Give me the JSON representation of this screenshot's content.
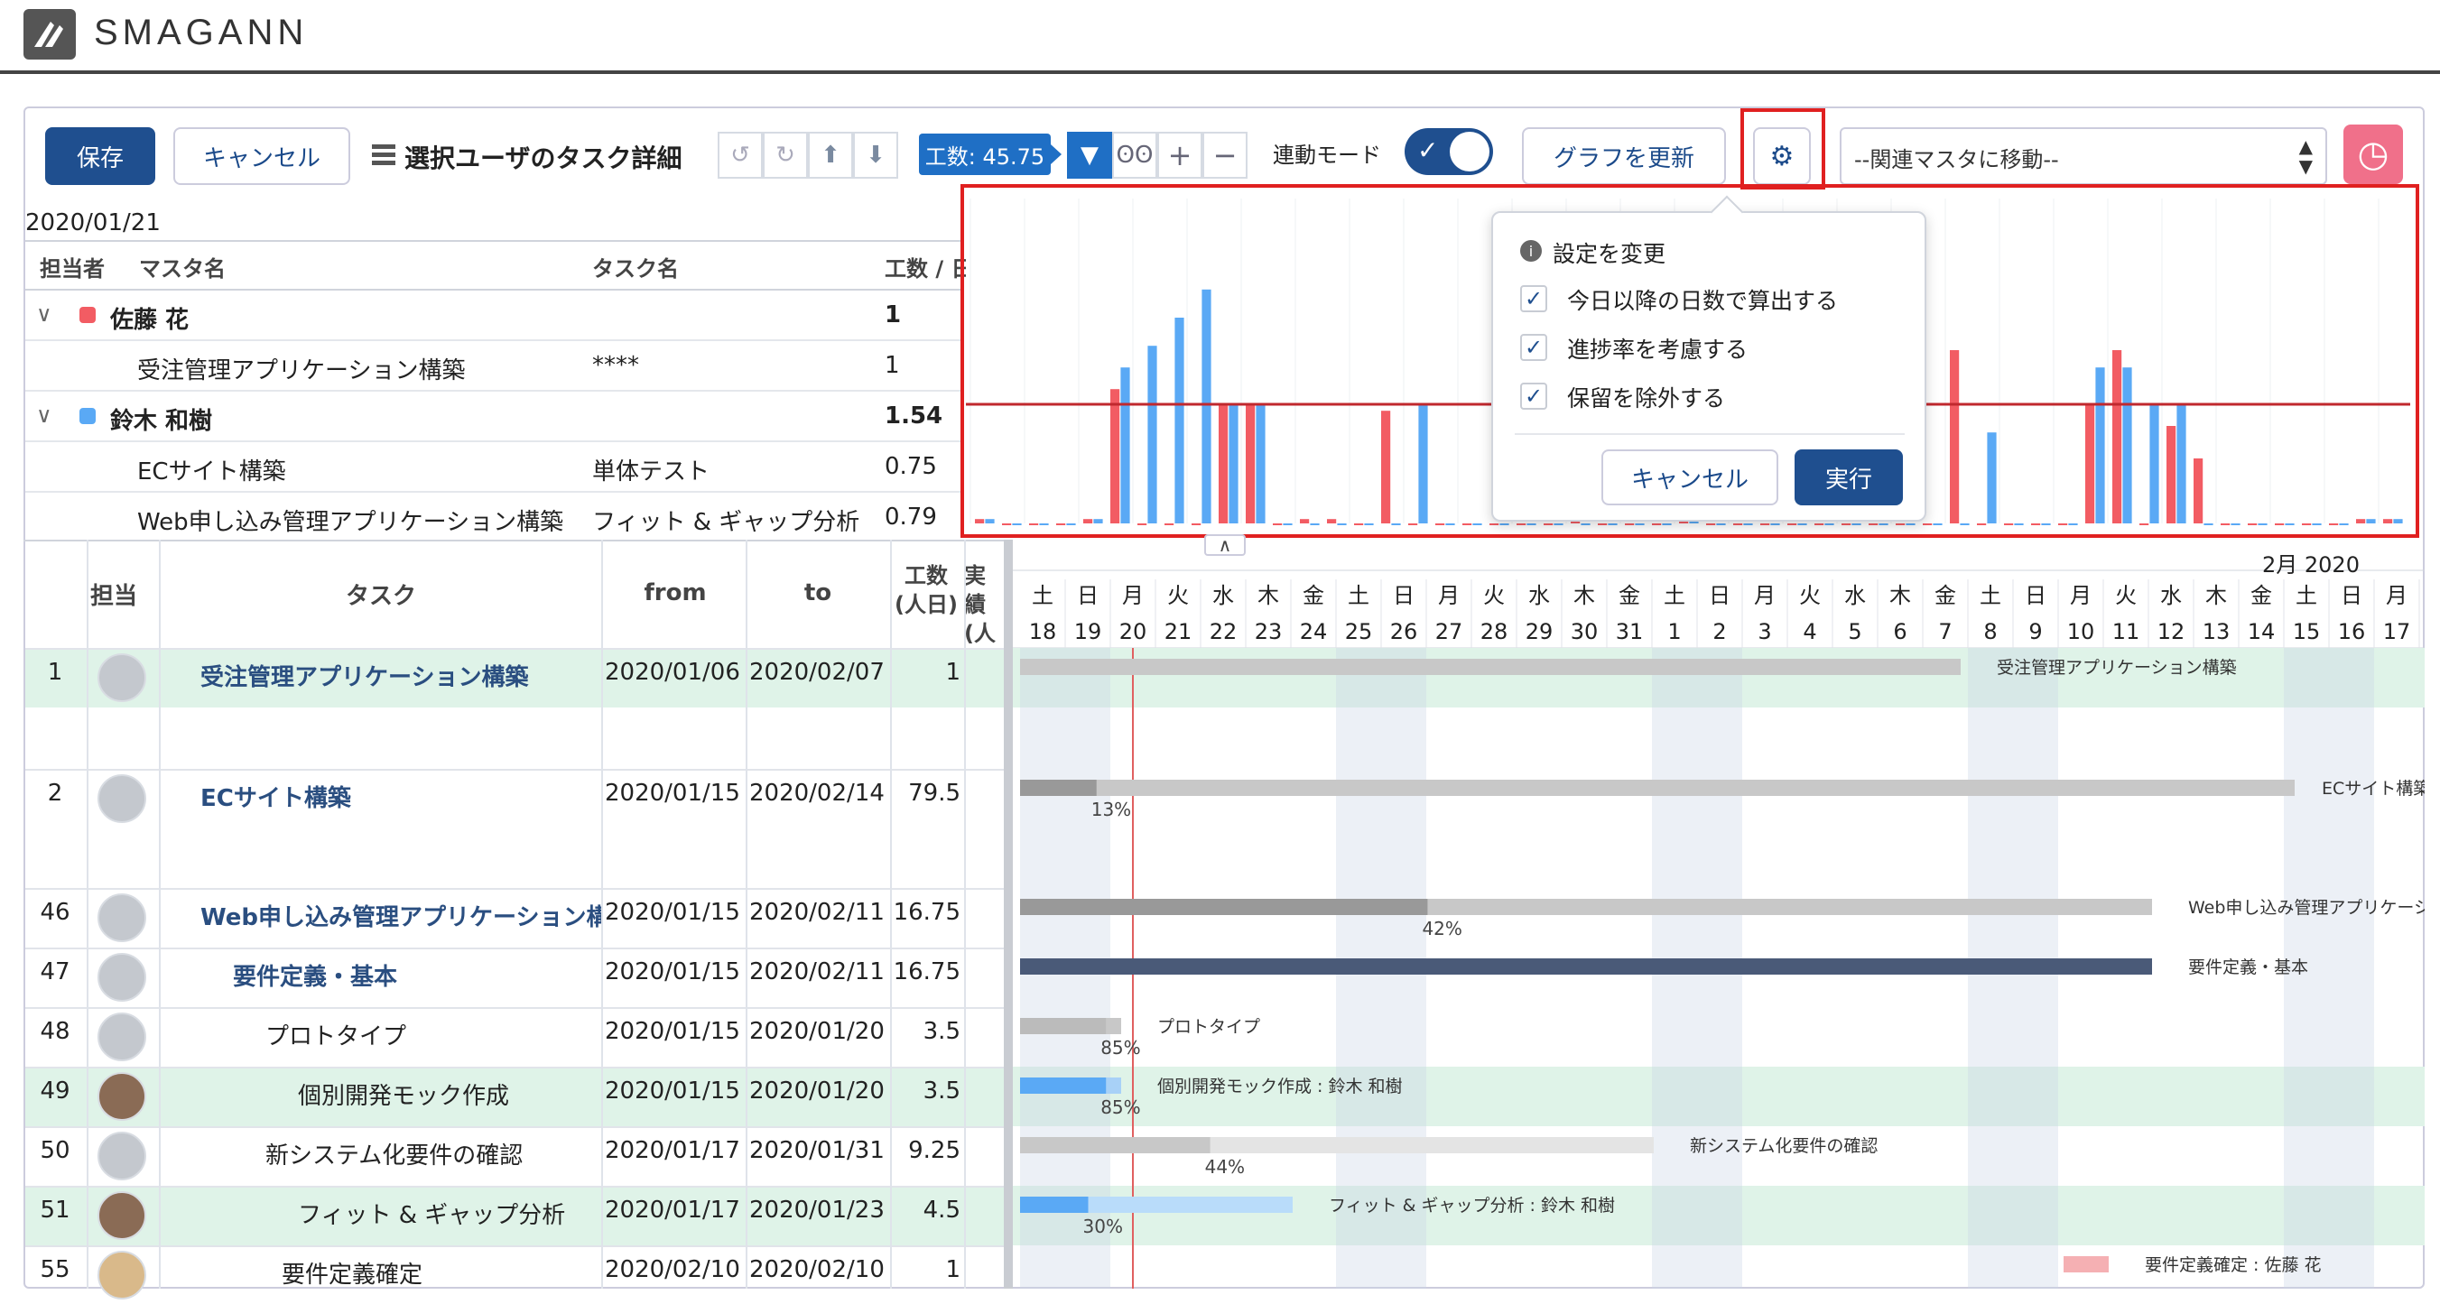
{
  "app": {
    "title": "SMAGANN"
  },
  "toolbar": {
    "save_label": "保存",
    "cancel_label": "キャンセル",
    "section_title": "選択ユーザのタスク詳細",
    "effort_label": "工数: 45.75",
    "link_mode_label": "連動モード",
    "update_graph_label": "グラフを更新",
    "related_master_select": "--関連マスタに移動--"
  },
  "summary": {
    "date": "2020/01/21",
    "headers": [
      "担当者",
      "マスタ名",
      "タスク名",
      "工数 / 日"
    ],
    "rows": [
      {
        "kind": "user",
        "name": "佐藤 花",
        "color": "#f25c63",
        "value": "1"
      },
      {
        "kind": "item",
        "master": "受注管理アプリケーション構築",
        "task": "****",
        "value": "1"
      },
      {
        "kind": "user",
        "name": "鈴木 和樹",
        "color": "#5aa9f5",
        "value": "1.54"
      },
      {
        "kind": "item",
        "master": "ECサイト構築",
        "task": "単体テスト",
        "value": "0.75"
      },
      {
        "kind": "item",
        "master": "Web申し込み管理アプリケーション構築",
        "task": "フィット & ギャップ分析",
        "value": "0.79"
      }
    ]
  },
  "settings_popup": {
    "title": "設定を変更",
    "options": [
      "今日以降の日数で算出する",
      "進捗率を考慮する",
      "保留を除外する"
    ],
    "cancel_label": "キャンセル",
    "run_label": "実行"
  },
  "chart_data": {
    "type": "bar",
    "series": [
      {
        "color": "#f25c63",
        "values": [
          0.02,
          0,
          0,
          0,
          0.02,
          0.62,
          0,
          0,
          0,
          0.55,
          0.55,
          0,
          0.02,
          0.02,
          0,
          0.52,
          0,
          0,
          0,
          0,
          0,
          0,
          0.02,
          0,
          0,
          0,
          0.98,
          0,
          0,
          0,
          0,
          0,
          0,
          0,
          0,
          0,
          0.8,
          0,
          0,
          0,
          0,
          0.55,
          0.8,
          0,
          0.45,
          0.3,
          0,
          0,
          0,
          0,
          0,
          0.02,
          0.02
        ]
      },
      {
        "color": "#5aa9f5",
        "values": [
          0.02,
          0,
          0,
          0,
          0.02,
          0.72,
          0.82,
          0.95,
          1.08,
          0.55,
          0.55,
          0,
          0,
          0,
          0,
          0,
          0.55,
          0,
          0,
          0,
          0,
          0,
          0,
          0,
          0,
          0,
          0.98,
          0,
          0,
          0,
          0,
          0,
          0,
          0,
          0,
          0,
          0,
          0.42,
          0,
          0,
          0,
          0.72,
          0.72,
          0.55,
          0.55,
          0,
          0,
          0,
          0,
          0,
          0,
          0.02,
          0.02
        ]
      }
    ],
    "threshold": 0.55
  },
  "gantt": {
    "headers": {
      "num": "",
      "owner": "担当",
      "task": "タスク",
      "from": "from",
      "to": "to",
      "effort": "工数\n(人日)",
      "actual": "実績\n(人日)"
    },
    "month_label": "2月 2020",
    "weekdays": [
      "土",
      "日",
      "月",
      "火",
      "水",
      "木",
      "金",
      "土",
      "日",
      "月",
      "火",
      "水",
      "木",
      "金",
      "土",
      "日",
      "月",
      "火",
      "水",
      "木",
      "金",
      "土",
      "日",
      "月",
      "火",
      "水",
      "木",
      "金",
      "土",
      "日",
      "月"
    ],
    "days": [
      "18",
      "19",
      "20",
      "21",
      "22",
      "23",
      "24",
      "25",
      "26",
      "27",
      "28",
      "29",
      "30",
      "31",
      "1",
      "2",
      "3",
      "4",
      "5",
      "6",
      "7",
      "8",
      "9",
      "10",
      "11",
      "12",
      "13",
      "14",
      "15",
      "16",
      "17"
    ],
    "rows": [
      {
        "no": "1",
        "task": "受注管理アプリケーション構築",
        "from": "2020/01/06",
        "to": "2020/02/07",
        "effort": "1",
        "bar_label": "受注管理アプリケーション構築",
        "progress": ""
      },
      {
        "no": "2",
        "task": "ECサイト構築",
        "from": "2020/01/15",
        "to": "2020/02/14",
        "effort": "79.5",
        "bar_label": "ECサイト構築",
        "progress": "13%"
      },
      {
        "no": "46",
        "task": "Web申し込み管理アプリケーション構築",
        "from": "2020/01/15",
        "to": "2020/02/11",
        "effort": "16.75",
        "bar_label": "Web申し込み管理アプリケーション構築",
        "progress": "42%"
      },
      {
        "no": "47",
        "task": "要件定義・基本",
        "from": "2020/01/15",
        "to": "2020/02/11",
        "effort": "16.75",
        "bar_label": "要件定義・基本",
        "progress": ""
      },
      {
        "no": "48",
        "task": "プロトタイプ",
        "from": "2020/01/15",
        "to": "2020/01/20",
        "effort": "3.5",
        "bar_label": "プロトタイプ",
        "progress": "85%"
      },
      {
        "no": "49",
        "task": "個別開発モック作成",
        "from": "2020/01/15",
        "to": "2020/01/20",
        "effort": "3.5",
        "bar_label": "個別開発モック作成 : 鈴木 和樹",
        "progress": "85%"
      },
      {
        "no": "50",
        "task": "新システム化要件の確認",
        "from": "2020/01/17",
        "to": "2020/01/31",
        "effort": "9.25",
        "bar_label": "新システム化要件の確認",
        "progress": "44%"
      },
      {
        "no": "51",
        "task": "フィット & ギャップ分析",
        "from": "2020/01/17",
        "to": "2020/01/23",
        "effort": "4.5",
        "bar_label": "フィット & ギャップ分析 : 鈴木 和樹",
        "progress": "30%"
      },
      {
        "no": "55",
        "task": "要件定義確定",
        "from": "2020/02/10",
        "to": "2020/02/10",
        "effort": "1",
        "bar_label": "要件定義確定 : 佐藤 花",
        "progress": ""
      }
    ]
  }
}
